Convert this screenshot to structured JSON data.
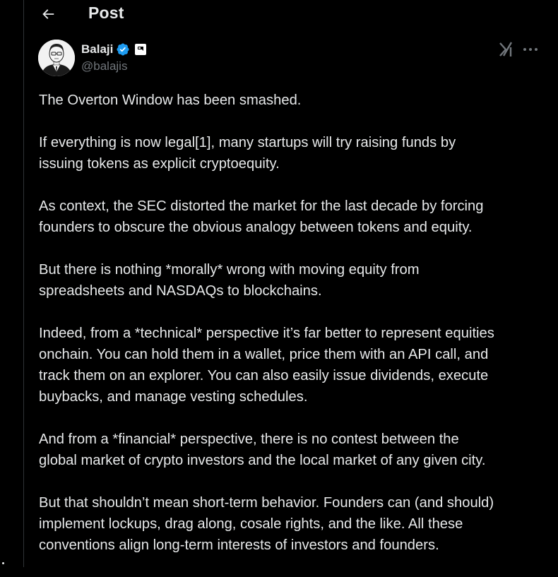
{
  "header": {
    "title": "Post"
  },
  "author": {
    "name": "Balaji",
    "handle": "@balajis"
  },
  "tweet": {
    "paragraphs": [
      "The Overton Window has been smashed.",
      "If everything is now legal[1], many startups will try raising funds by\nissuing tokens as explicit cryptoequity.",
      "As context, the SEC distorted the market for the last decade by forcing\nfounders to obscure the obvious analogy between tokens and equity.",
      "But there is nothing *morally* wrong with moving equity from\nspreadsheets and NASDAQs to blockchains.",
      "Indeed, from a *technical* perspective it’s far better to represent equities\nonchain. You can hold them in a wallet, price them with an API call, and\ntrack them on an explorer. You can also easily issue dividends, execute\nbuybacks, and manage vesting schedules.",
      "And from a *financial* perspective, there is no contest between the\nglobal market of crypto investors and the local market of any given city.",
      "But that shouldn’t mean short-term behavior. Founders can (and should)\nimplement lockups, drag along, cosale rights, and the like. All these\nconventions align long-term interests of investors and founders."
    ]
  },
  "icons": {
    "back": "arrow-left-icon",
    "verified": "verified-badge-icon",
    "affiliate": "affiliate-badge-icon",
    "grok": "grok-icon",
    "more": "more-dots-icon"
  },
  "colors": {
    "background": "#000000",
    "text": "#e7e9ea",
    "secondary_text": "#71767b",
    "verified_blue": "#1d9bf0",
    "border": "#2f3336"
  }
}
